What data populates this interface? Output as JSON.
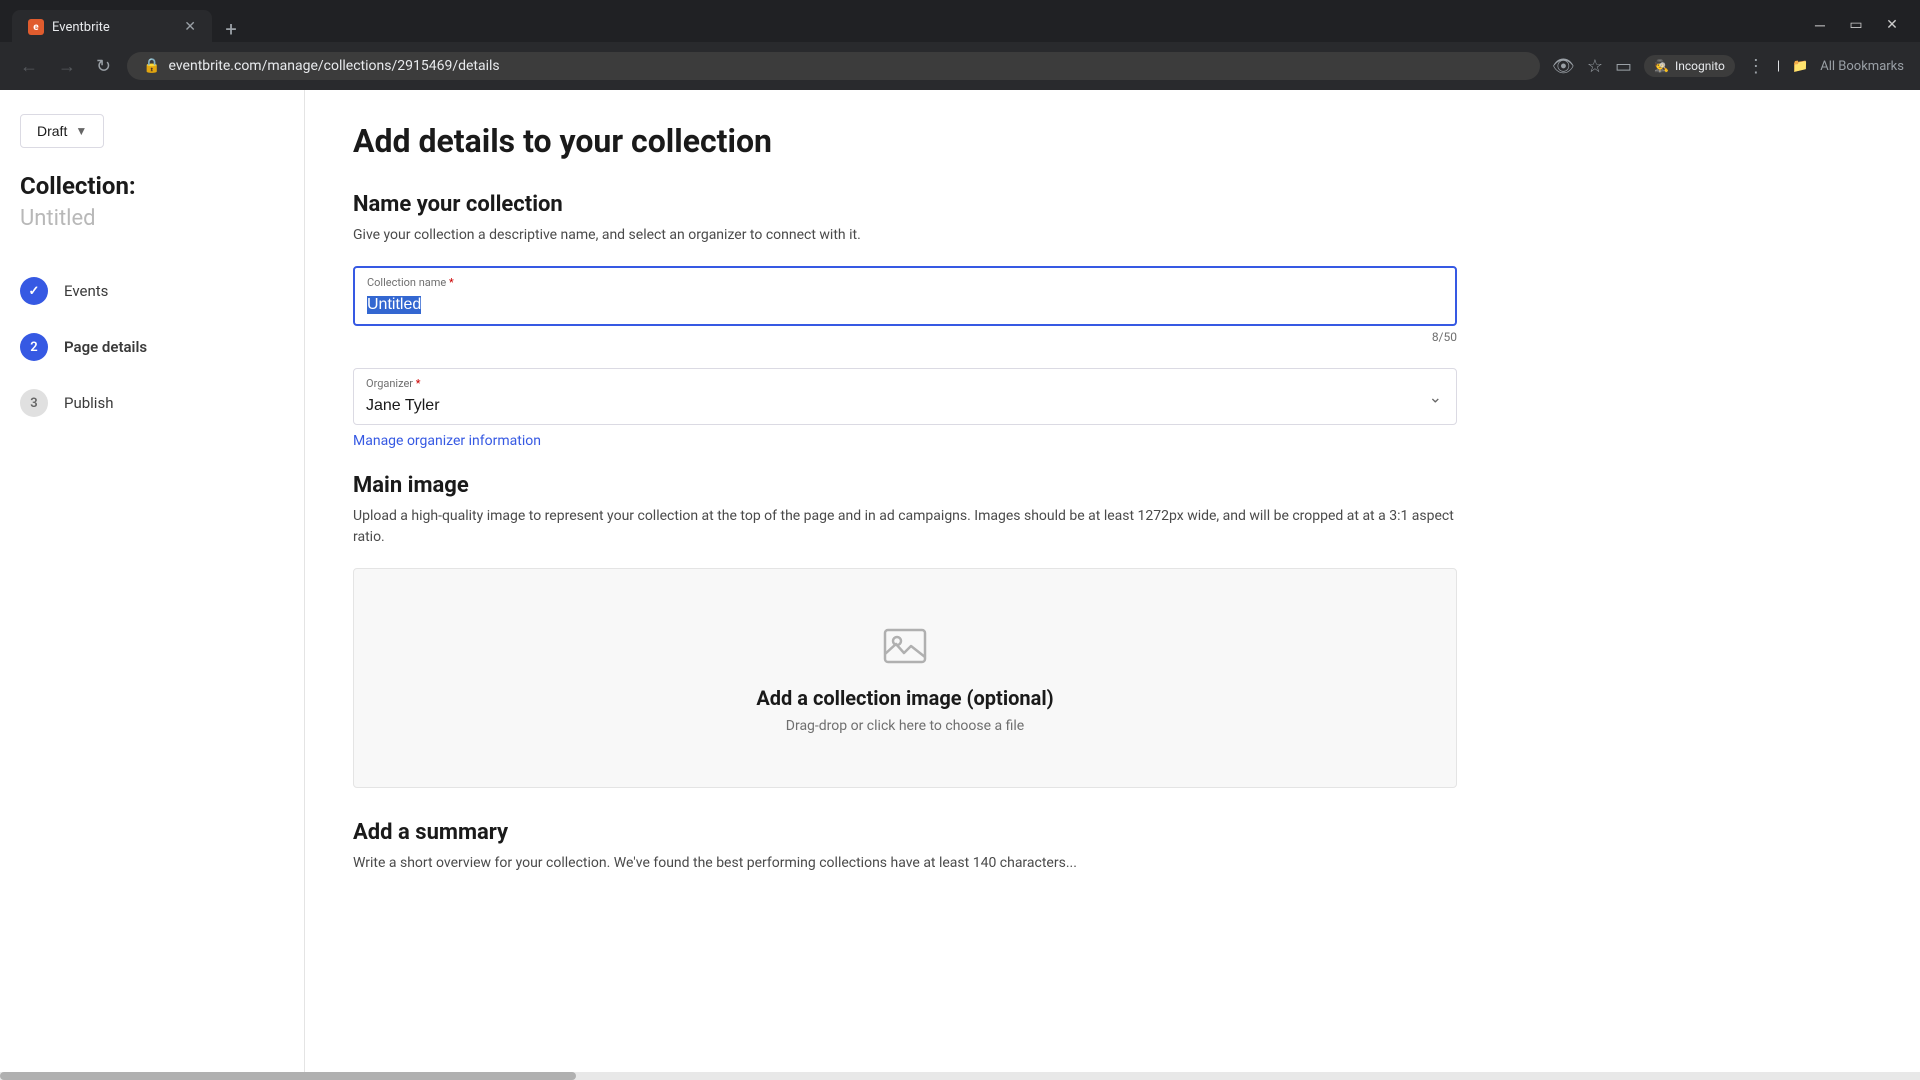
{
  "browser": {
    "tab_label": "Eventbrite",
    "tab_favicon": "e",
    "address_url": "eventbrite.com/manage/collections/2915469/details",
    "incognito_label": "Incognito",
    "bookmarks_label": "All Bookmarks"
  },
  "sidebar": {
    "draft_button": "Draft",
    "collection_label": "Collection:",
    "collection_name": "Untitled",
    "nav_items": [
      {
        "step": "✓",
        "label": "Events",
        "state": "completed"
      },
      {
        "step": "2",
        "label": "Page details",
        "state": "active"
      },
      {
        "step": "3",
        "label": "Publish",
        "state": "inactive"
      }
    ]
  },
  "main": {
    "page_title": "Add details to your collection",
    "name_section": {
      "title": "Name your collection",
      "description": "Give your collection a descriptive name, and select an organizer to connect with it.",
      "collection_name_label": "Collection name",
      "collection_name_required": "*",
      "collection_name_value": "Untitled",
      "char_count": "8/50"
    },
    "organizer_section": {
      "label": "Organizer",
      "required": "*",
      "value": "Jane Tyler",
      "manage_link": "Manage organizer information"
    },
    "image_section": {
      "title": "Main image",
      "description": "Upload a high-quality image to represent your collection at the top of the page and in ad campaigns. Images should be at least 1272px wide, and will be cropped at at a 3:1 aspect ratio.",
      "upload_title": "Add a collection image (optional)",
      "upload_sub": "Drag-drop or click here to choose a file"
    },
    "summary_section": {
      "title": "Add a summary",
      "description": "Write a short overview for your collection. We've found the best performing collections have at least 140 characters..."
    }
  }
}
